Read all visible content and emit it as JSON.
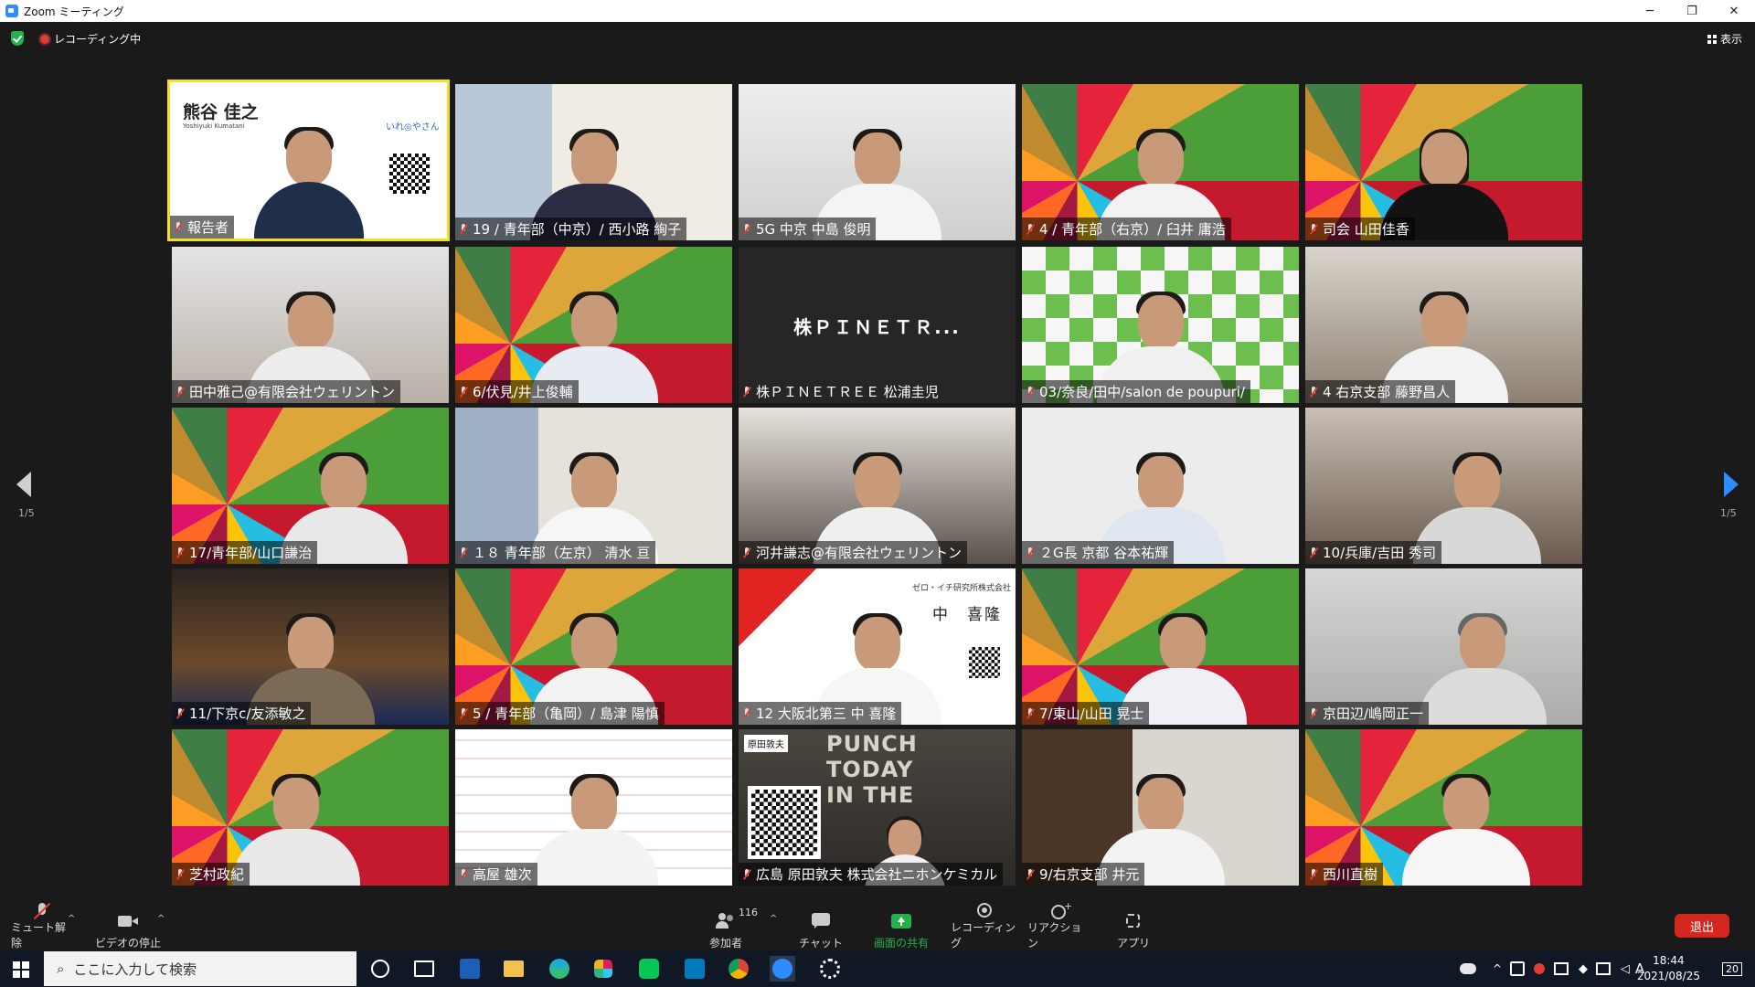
{
  "window": {
    "title": "Zoom ミーティング",
    "minimize": "─",
    "maximize": "❐",
    "close": "✕"
  },
  "meeting": {
    "recording_label": "レコーディング中",
    "view_label": "表示"
  },
  "pagination": {
    "left": "1/5",
    "right": "1/5"
  },
  "tiles": [
    {
      "name": "報告者",
      "slide_name": "熊谷 佳之",
      "slide_sub": "Yoshiyuki Kumatani",
      "slide_brand": "いれ◎やさん"
    },
    {
      "name": "19 / 青年部（中京）/ 西小路 絢子"
    },
    {
      "name": "5G 中京 中島 俊明"
    },
    {
      "name": "4 / 青年部（右京）/ 臼井 庸浩"
    },
    {
      "name": "司会 山田佳香"
    },
    {
      "name": "田中雅己@有限会社ウェリントン"
    },
    {
      "name": "6/伏見/井上俊輔"
    },
    {
      "name": "株ＰＩＮＥＴＲＥＥ 松浦圭児",
      "center_text": "株ＰＩＮＥＴＲ..."
    },
    {
      "name": "03/奈良/田中/salon de poupuri/"
    },
    {
      "name": "4 右京支部 藤野昌人"
    },
    {
      "name": "17/青年部/山口謙治"
    },
    {
      "name": "１８ 青年部（左京） 清水 亘"
    },
    {
      "name": "河井謙志@有限会社ウェリントン"
    },
    {
      "name": "２G長 京都 谷本祐輝"
    },
    {
      "name": "10/兵庫/吉田 秀司"
    },
    {
      "name": "11/下京c/友添敏之"
    },
    {
      "name": "5 / 青年部（亀岡）/ 島津 陽慎"
    },
    {
      "name": "12 大阪北第三 中 喜隆",
      "card_company": "ゼロ・イチ研究所株式会社",
      "card_name": "中　喜隆"
    },
    {
      "name": "7/東山/山田 晃士"
    },
    {
      "name": "京田辺/嶋岡正一"
    },
    {
      "name": "芝村政紀"
    },
    {
      "name": "高屋 雄次"
    },
    {
      "name": "広島 原田敦夫 株式会社ニホンケミカル",
      "bg_text": "PUNCH TODAY IN THE",
      "card_name": "原田敦夫"
    },
    {
      "name": "9/右京支部 井元"
    },
    {
      "name": "西川直樹"
    }
  ],
  "toolbar": {
    "mute": "ミュート解除",
    "video": "ビデオの停止",
    "participants": "参加者",
    "participant_count": "116",
    "chat": "チャット",
    "share": "画面の共有",
    "record": "レコーディング",
    "reaction": "リアクション",
    "apps": "アプリ",
    "leave": "退出"
  },
  "taskbar": {
    "search_placeholder": "ここに入力して検索",
    "time": "18:44",
    "date": "2021/08/25",
    "ime": "A",
    "notifications": "20"
  },
  "colors": {
    "share_green": "#22b14c",
    "leave_red": "#d2261f",
    "spotlight_yellow": "#f3e21b",
    "zoom_blue": "#2d8cff"
  }
}
